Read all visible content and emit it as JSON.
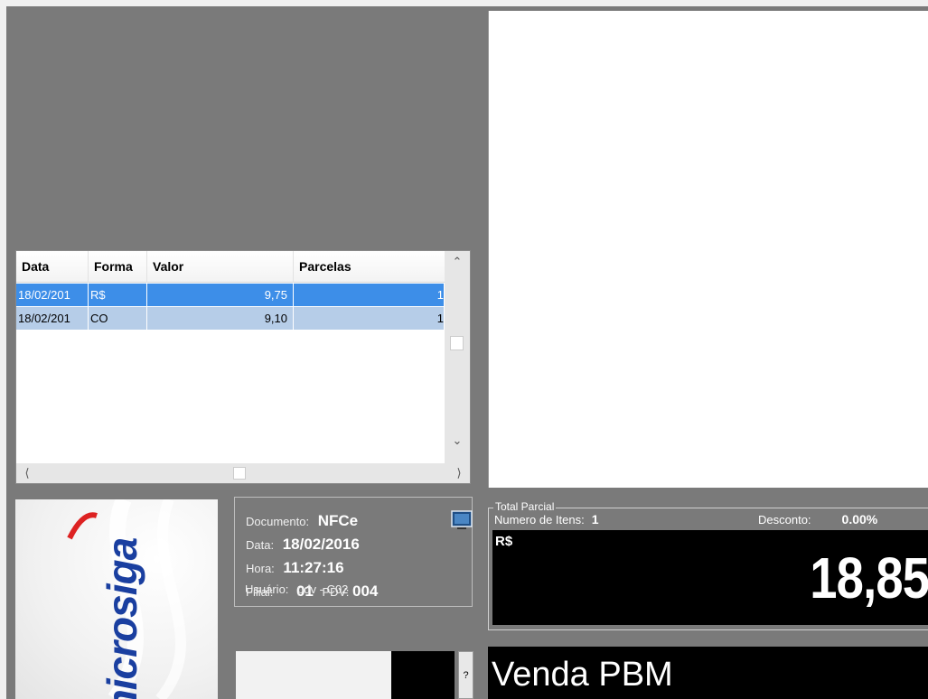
{
  "grid": {
    "columns": [
      "Data",
      "Forma",
      "Valor",
      "Parcelas"
    ],
    "rows": [
      {
        "data": "18/02/201",
        "forma": "R$",
        "valor": "9,75",
        "parcelas": "1"
      },
      {
        "data": "18/02/201",
        "forma": "CO",
        "valor": "9,10",
        "parcelas": "1"
      }
    ]
  },
  "logo": {
    "text": "microsiga"
  },
  "doc": {
    "documento_label": "Documento:",
    "documento_value": "NFCe",
    "data_label": "Data:",
    "data_value": "18/02/2016",
    "hora_label": "Hora:",
    "hora_value": "11:27:16",
    "filial_label": "Filial:",
    "filial_value": "01",
    "pdv_label": "PDV:",
    "pdv_value": "004",
    "usuario_label": "Usuário:",
    "usuario_value": "pdv - C02"
  },
  "total": {
    "legend": "Total Parcial",
    "numitens_label": "Numero de Itens:",
    "numitens_value": "1",
    "desconto_label": "Desconto:",
    "desconto_value": "0.00%",
    "currency": "R$",
    "amount": "18,85"
  },
  "bottom": {
    "help_label": "?",
    "venda_label": "Venda PBM"
  },
  "colors": {
    "background": "#7a7a7a",
    "selected_row": "#3d8ee8",
    "alt_row": "#b6cde8",
    "logo_blue": "#1a3fa0"
  }
}
